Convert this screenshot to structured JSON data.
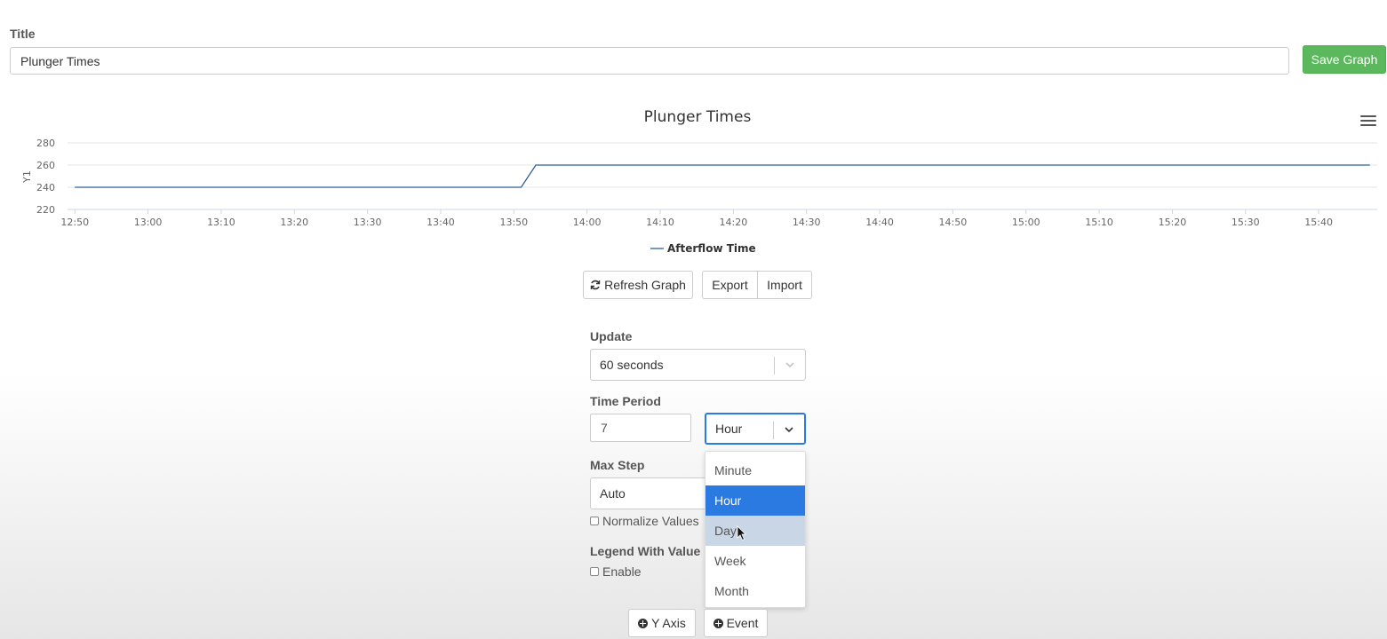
{
  "title_field": {
    "label": "Title",
    "value": "Plunger Times"
  },
  "save_button": {
    "label": "Save Graph",
    "color": "#5cb85c"
  },
  "chart_data": {
    "type": "line",
    "title": "Plunger Times",
    "ylabel": "Y1",
    "xlabel": "",
    "ylim": [
      220,
      280
    ],
    "yticks": [
      220,
      240,
      260,
      280
    ],
    "xticks": [
      "12:50",
      "13:00",
      "13:10",
      "13:20",
      "13:30",
      "13:40",
      "13:50",
      "14:00",
      "14:10",
      "14:20",
      "14:30",
      "14:40",
      "14:50",
      "15:00",
      "15:10",
      "15:20",
      "15:30",
      "15:40"
    ],
    "xlim": [
      "12:49",
      "15:48"
    ],
    "grid": true,
    "legend_position": "bottom-center",
    "series": [
      {
        "name": "Afterflow Time",
        "color": "#2f5f98",
        "x": [
          "12:50",
          "13:51",
          "13:53",
          "15:47"
        ],
        "values": [
          240,
          240,
          260,
          260
        ]
      }
    ]
  },
  "chart_menu": {
    "icon": "hamburger-menu-icon"
  },
  "toolbar": {
    "refresh_label": "Refresh Graph",
    "refresh_icon": "refresh-icon",
    "export_label": "Export",
    "import_label": "Import"
  },
  "update": {
    "label": "Update",
    "value": "60 seconds"
  },
  "time_period": {
    "label": "Time Period",
    "amount": "7",
    "unit": "Hour",
    "options": [
      "Minute",
      "Hour",
      "Day",
      "Week",
      "Month"
    ],
    "selected": "Hour",
    "hovered": "Day",
    "accent": "#2a7ae2"
  },
  "max_step": {
    "label": "Max Step",
    "value": "Auto"
  },
  "normalize": {
    "label": "Normalize Values"
  },
  "legend_with_value": {
    "label": "Legend With Value",
    "enable_label": "Enable"
  },
  "bottom_buttons": {
    "y_axis_label": "Y Axis",
    "event_label": "Event"
  }
}
